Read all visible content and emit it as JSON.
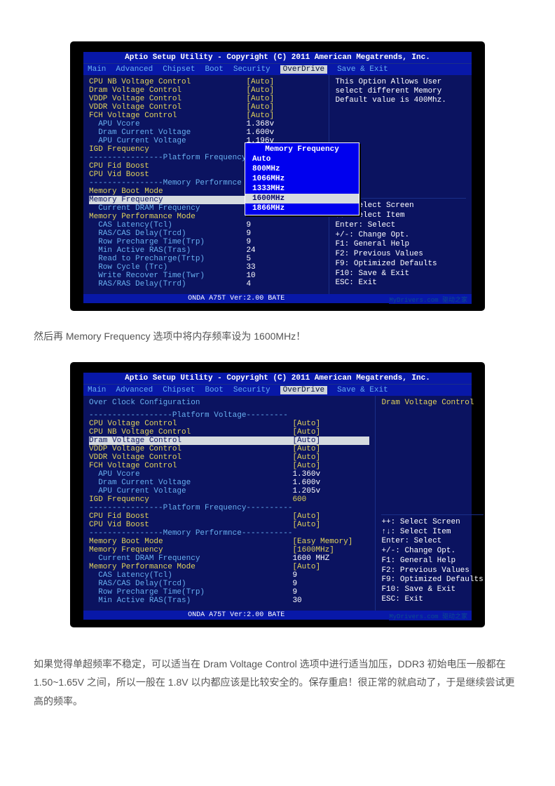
{
  "title": "Aptio Setup Utility - Copyright (C) 2011 American Megatrends, Inc.",
  "tabs": [
    "Main",
    "Advanced",
    "Chipset",
    "Boot",
    "Security",
    "OverDrive",
    "Save & Exit"
  ],
  "activeTab": "OverDrive",
  "footer": "ONDA A75T Ver:2.00 BATE",
  "watermark": "MyDrivers.com 驱动之家",
  "keys": {
    "a": "++: Select Screen",
    "b": "↑↓: Select Item",
    "c": "Enter: Select",
    "d": "+/-: Change Opt.",
    "e": "F1: General Help",
    "f": "F2: Previous Values",
    "g": "F9: Optimized Defaults",
    "h": "F10: Save & Exit",
    "i": "ESC: Exit"
  },
  "bios1": {
    "help": "This Option Allows User select different Memory Default value is 400Mhz.",
    "rows": [
      {
        "l": "CPU NB Voltage Control",
        "v": "[Auto]",
        "y": 1
      },
      {
        "l": "Dram Voltage Control",
        "v": "[Auto]",
        "y": 1
      },
      {
        "l": "VDDP Voltage Control",
        "v": "[Auto]",
        "y": 1
      },
      {
        "l": "VDDR Voltage Control",
        "v": "[Auto]",
        "y": 1
      },
      {
        "l": "FCH Voltage Control",
        "v": "[Auto]",
        "y": 1
      },
      {
        "l": "  APU Vcore",
        "v": "1.368v"
      },
      {
        "l": "  Dram Current Voltage",
        "v": "1.600v"
      },
      {
        "l": "  APU Current Voltage",
        "v": "1.196v"
      },
      {
        "l": "IGD Frequency",
        "v": "",
        "y": 1
      },
      {
        "l": "----------------Platform Frequency",
        "v": ""
      },
      {
        "l": "CPU Fid Boost",
        "v": "",
        "y": 1
      },
      {
        "l": "CPU Vid Boost",
        "v": "",
        "y": 1
      },
      {
        "l": "----------------Memory Performnce",
        "v": ""
      },
      {
        "l": "Memory Boot Mode",
        "v": "",
        "y": 1
      },
      {
        "l": "Memory Frequency",
        "v": "",
        "hl": 1
      },
      {
        "l": "  Current DRAM Frequency",
        "v": ""
      },
      {
        "l": "Memory Performance Mode",
        "v": "",
        "y": 1
      },
      {
        "l": "  CAS Latency(Tcl)",
        "v": "9"
      },
      {
        "l": "  RAS/CAS Delay(Trcd)",
        "v": "9"
      },
      {
        "l": "  Row Precharge Time(Trp)",
        "v": "9"
      },
      {
        "l": "  Min Active RAS(Tras)",
        "v": "24"
      },
      {
        "l": "  Read to Precharge(Trtp)",
        "v": "5"
      },
      {
        "l": "  Row Cycle (Trc)",
        "v": "33"
      },
      {
        "l": "  Write Recover Time(Twr)",
        "v": "10"
      },
      {
        "l": "  RAS/RAS Delay(Trrd)",
        "v": "4"
      }
    ],
    "popup": {
      "title": "Memory Frequency",
      "opts": [
        "Auto",
        "800MHz",
        "1066MHz",
        "1333MHz",
        "1600MHz",
        "1866MHz"
      ],
      "sel": "1600MHz"
    }
  },
  "p1": "然后再 Memory Frequency 选项中将内存频率设为 1600MHz！",
  "bios2": {
    "help": "Dram Voltage Control",
    "section": "Over Clock Configuration",
    "rows": [
      {
        "l": "------------------Platform Voltage---------",
        "v": ""
      },
      {
        "l": "CPU Voltage Control",
        "v": "[Auto]",
        "y": 1
      },
      {
        "l": "CPU NB Voltage Control",
        "v": "[Auto]",
        "y": 1
      },
      {
        "l": "Dram Voltage Control",
        "v": "[Auto]",
        "hl": 1
      },
      {
        "l": "VDDP Voltage Control",
        "v": "[Auto]",
        "y": 1
      },
      {
        "l": "VDDR Voltage Control",
        "v": "[Auto]",
        "y": 1
      },
      {
        "l": "FCH Voltage Control",
        "v": "[Auto]",
        "y": 1
      },
      {
        "l": "  APU Vcore",
        "v": "1.360v"
      },
      {
        "l": "  Dram Current Voltage",
        "v": "1.600v"
      },
      {
        "l": "  APU Current Voltage",
        "v": "1.205v"
      },
      {
        "l": "IGD Frequency",
        "v": "600",
        "y": 1
      },
      {
        "l": "----------------Platform Frequency----------",
        "v": ""
      },
      {
        "l": "CPU Fid Boost",
        "v": "[Auto]",
        "y": 1
      },
      {
        "l": "CPU Vid Boost",
        "v": "[Auto]",
        "y": 1
      },
      {
        "l": "----------------Memory Performnce-----------",
        "v": ""
      },
      {
        "l": "Memory Boot Mode",
        "v": "[Easy Memory]",
        "y": 1
      },
      {
        "l": "Memory Frequency",
        "v": "[1600MHz]",
        "y": 1
      },
      {
        "l": "  Current DRAM Frequency",
        "v": "1600 MHZ"
      },
      {
        "l": "Memory Performance Mode",
        "v": "[Auto]",
        "y": 1
      },
      {
        "l": "  CAS Latency(Tcl)",
        "v": "9"
      },
      {
        "l": "  RAS/CAS Delay(Trcd)",
        "v": "9"
      },
      {
        "l": "  Row Precharge Time(Trp)",
        "v": "9"
      },
      {
        "l": "  Min Active RAS(Tras)",
        "v": "30"
      }
    ]
  },
  "p2": "如果觉得单超频率不稳定，可以适当在 Dram Voltage Control 选项中进行适当加压，DDR3 初始电压一般都在 1.50~1.65V 之间，所以一般在 1.8V 以内都应该是比较安全的。保存重启！很正常的就启动了，于是继续尝试更高的频率。"
}
